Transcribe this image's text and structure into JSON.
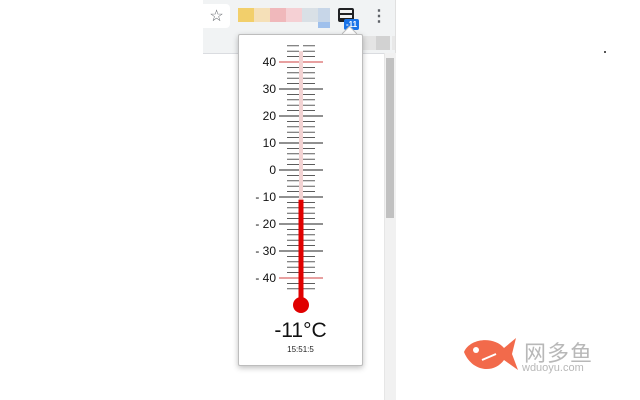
{
  "browser": {
    "star_icon": "☆",
    "menu_icon": "⋮",
    "extension": {
      "icon": "calendar-grid-icon",
      "badge": "-11"
    },
    "extension_colors": [
      "#f2cf6b",
      "#f5e0b8",
      "#f0b8bb",
      "#f5d0d4",
      "#d9e0e6",
      "#c7d6e8",
      "#9fc0ec"
    ],
    "tab_colors": [
      "#e4e4e4",
      "#d2d2d2",
      "#e8e8e8"
    ]
  },
  "popup": {
    "scale_labels": [
      "40",
      "30",
      "20",
      "10",
      "0",
      "- 10",
      "- 20",
      "- 30",
      "- 40"
    ],
    "reading": {
      "temperature": "-11°C",
      "time": "15:51:5"
    },
    "level": {
      "value": -11,
      "min": -40,
      "max": 40
    },
    "colors": {
      "mercury": "#e00000",
      "redline": "#d04040"
    }
  },
  "watermark": {
    "brand_cn": "网多鱼",
    "url": "wduoyu.com",
    "logo_color": "#f26a4b"
  }
}
